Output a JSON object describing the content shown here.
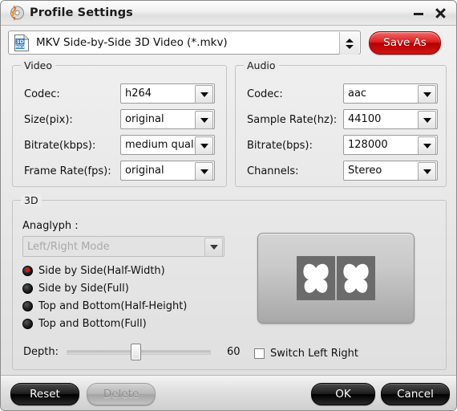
{
  "window": {
    "title": "Profile Settings",
    "app_icon": "disc-flame-icon",
    "minimize_label": "–",
    "close_label": "✕"
  },
  "format": {
    "icon": "mkv-3d-file-icon",
    "value": "MKV Side-by-Side 3D Video (*.mkv)",
    "spinner": "up-down-spinner",
    "save_as_label": "Save As"
  },
  "video": {
    "legend": "Video",
    "fields": [
      {
        "label": "Codec:",
        "value": "h264"
      },
      {
        "label": "Size(pix):",
        "value": "original"
      },
      {
        "label": "Bitrate(kbps):",
        "value": "medium quality"
      },
      {
        "label": "Frame Rate(fps):",
        "value": "original"
      }
    ]
  },
  "audio": {
    "legend": "Audio",
    "fields": [
      {
        "label": "Codec:",
        "value": "aac"
      },
      {
        "label": "Sample Rate(hz):",
        "value": "44100"
      },
      {
        "label": "Bitrate(bps):",
        "value": "128000"
      },
      {
        "label": "Channels:",
        "value": "Stereo"
      }
    ]
  },
  "three_d": {
    "legend": "3D",
    "anaglyph_label": "Anaglyph :",
    "anaglyph_value": "Left/Right Mode",
    "anaglyph_disabled": true,
    "modes": [
      {
        "label": "Side by Side(Half-Width)",
        "selected": true
      },
      {
        "label": "Side by Side(Full)",
        "selected": false
      },
      {
        "label": "Top and Bottom(Half-Height)",
        "selected": false
      },
      {
        "label": "Top and Bottom(Full)",
        "selected": false
      }
    ],
    "preview": {
      "name": "side-by-side-3d-preview",
      "panes": 2,
      "glyph": "butterfly-icon"
    },
    "depth_label": "Depth:",
    "depth_value": "60",
    "depth_percent": 48,
    "switch_label": "Switch Left Right",
    "switch_checked": false
  },
  "footer": {
    "reset_label": "Reset",
    "delete_label": "Delete",
    "delete_disabled": true,
    "ok_label": "OK",
    "cancel_label": "Cancel"
  },
  "colors": {
    "accent_red": "#d01414",
    "radio_selected": "#e01010",
    "dialog_bg": "#e9e9e9"
  }
}
